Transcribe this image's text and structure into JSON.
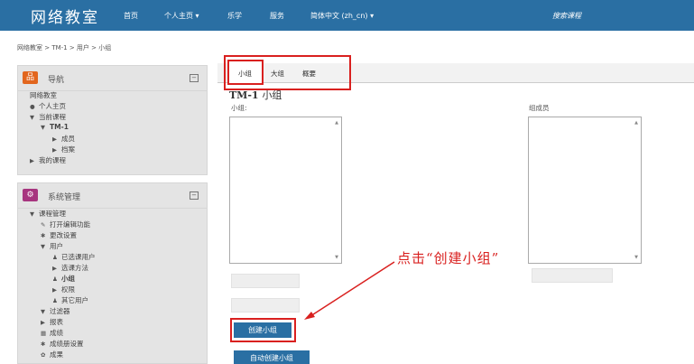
{
  "navbar": {
    "brand": "网络教室",
    "items": [
      "首页",
      "个人主页 ▾",
      "乐学",
      "服务",
      "简体中文 (zh_cn) ▾"
    ],
    "search": "搜索课程"
  },
  "breadcrumb": "网络教室 > TM-1 > 用户 > 小组",
  "navigation": {
    "title": "导航",
    "items": [
      "网络教室",
      "个人主页",
      "当前课程",
      "TM-1",
      "成员",
      "档案",
      "我的课程"
    ]
  },
  "admin": {
    "title": "系统管理",
    "items": [
      "课程管理",
      "打开编辑功能",
      "更改设置",
      "用户",
      "已选课用户",
      "选课方法",
      "小组",
      "权限",
      "其它用户",
      "过滤器",
      "报表",
      "成绩",
      "成绩册设置",
      "成果"
    ]
  },
  "tabs": [
    "小组",
    "大组",
    "概要"
  ],
  "course": {
    "code": "TM-1",
    "suffix": "小组"
  },
  "labels": {
    "groups": "小组:",
    "members": "组成员"
  },
  "buttons": {
    "create_group": "创建小组",
    "auto_create": "自动创建小组"
  },
  "annotation": "点击“创建小组”",
  "colors": {
    "brand": "#2a6fa3",
    "highlight": "#d9201f",
    "nav_icon": "#e2661e",
    "admin_icon": "#a7357f"
  }
}
